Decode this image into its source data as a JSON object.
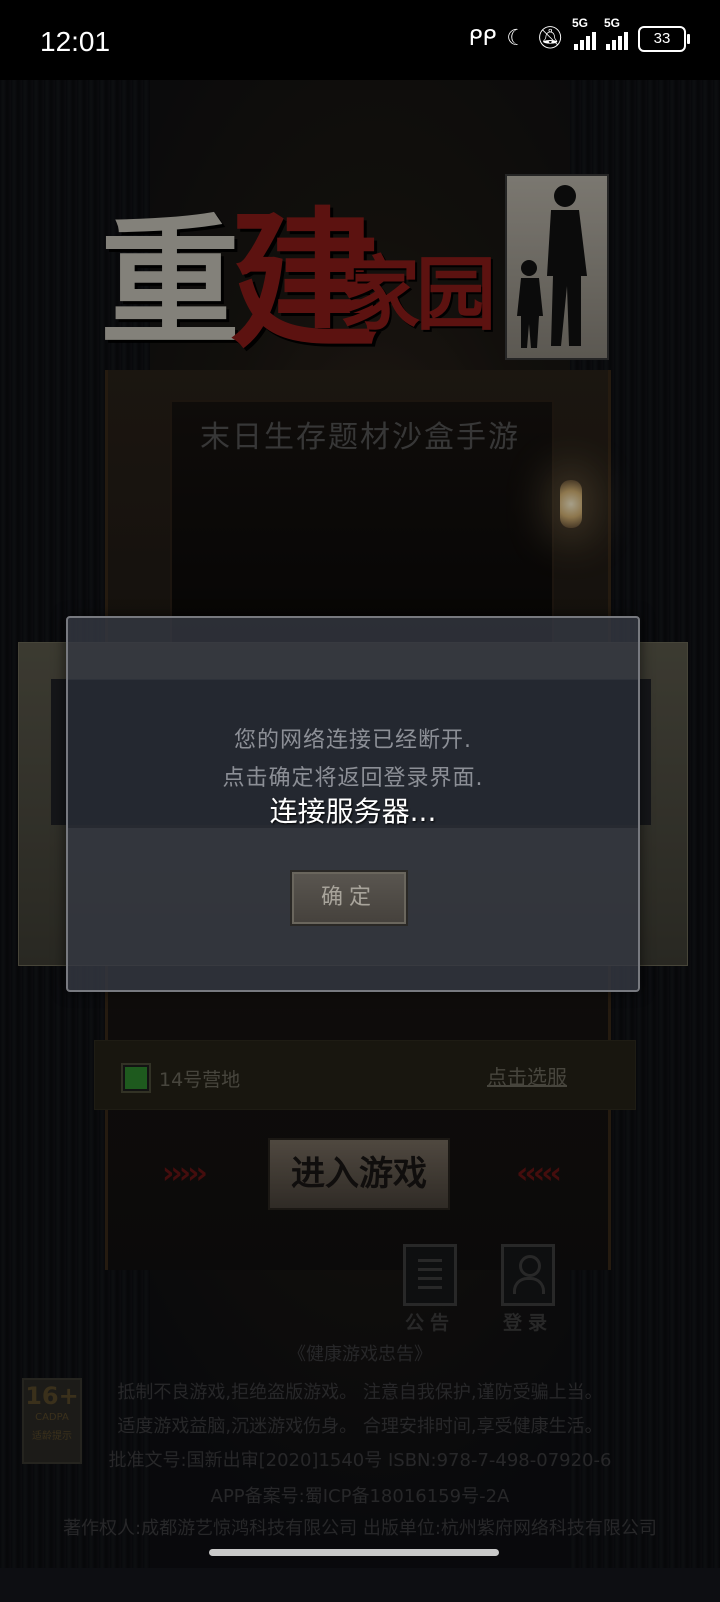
{
  "status_bar": {
    "time": "12:01",
    "signal1_tag": "5G",
    "signal2_tag": "5G",
    "battery": "33"
  },
  "game": {
    "logo_char1": "重",
    "logo_char2": "建",
    "logo_char3": "家园",
    "subtitle": "末日生存题材沙盒手游",
    "server_name": "14号营地",
    "select_server": "点击选服",
    "enter_game": "进入游戏",
    "arrows_left": "›››››",
    "arrows_right": "‹‹‹‹‹",
    "notice_label": "公告",
    "login_label": "登录"
  },
  "dialog": {
    "line1": "您的网络连接已经断开.",
    "line2": "点击确定将返回登录界面.",
    "connecting": "连接服务器...",
    "confirm": "确定"
  },
  "footer": {
    "advisory_title": "《健康游戏忠告》",
    "advisory_line1": "抵制不良游戏,拒绝盗版游戏。 注意自我保护,谨防受骗上当。",
    "advisory_line2": "适度游戏益脑,沉迷游戏伤身。 合理安排时间,享受健康生活。",
    "approval": "批准文号:国新出审[2020]1540号   ISBN:978-7-498-07920-6",
    "app_record": "APP备案号:蜀ICP备18016159号-2A",
    "copyright": "著作权人:成都游艺惊鸿科技有限公司 出版单位:杭州紫府网络科技有限公司",
    "age_rating": "16+",
    "age_org": "CADPA",
    "age_hint": "适龄提示"
  },
  "colors": {
    "dialog_bg": "#343842",
    "logo_red": "#8e1c1a",
    "server_check": "#2e8b2e"
  }
}
